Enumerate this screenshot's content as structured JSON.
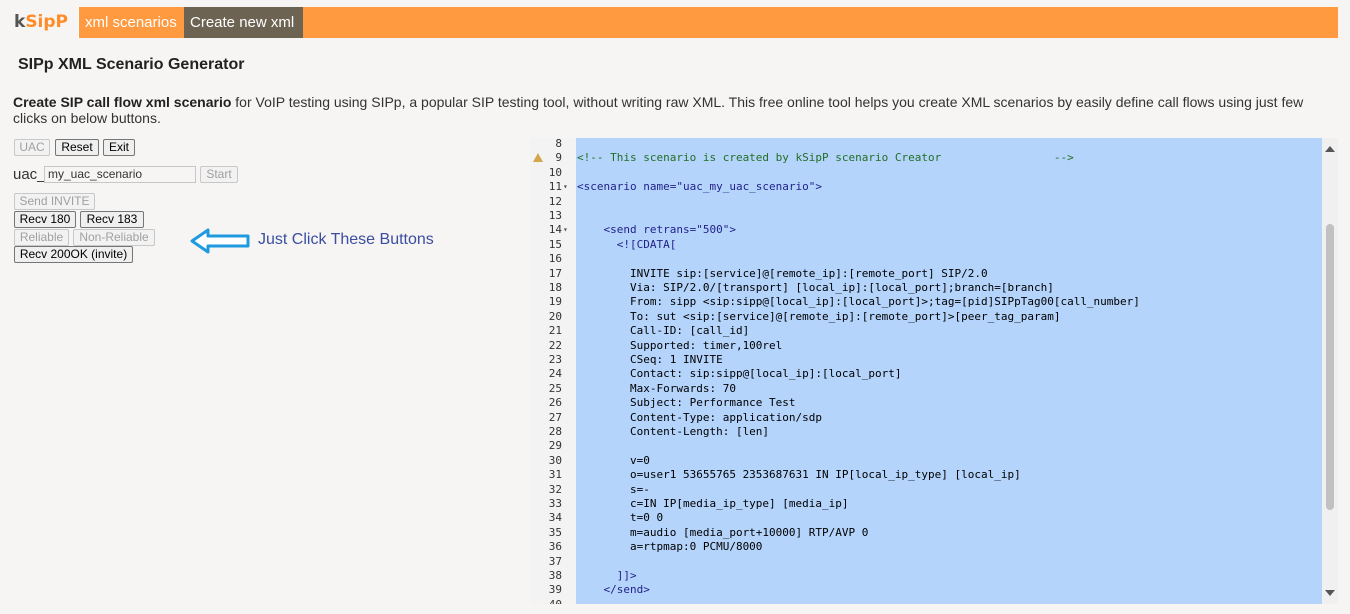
{
  "header": {
    "logo_k": "k",
    "logo_rest": "SipP",
    "tabs": [
      {
        "label": "xml scenarios"
      },
      {
        "label": "Create new xml"
      }
    ]
  },
  "main": {
    "title": "SIPp XML Scenario Generator",
    "desc_bold": "Create SIP call flow xml scenario",
    "desc_rest": " for VoIP testing using SIPp, a popular SIP testing tool, without writing raw XML. This free online tool helps you create XML scenarios by easily define call flows using just few clicks on below buttons."
  },
  "controls": {
    "uac": "UAC",
    "reset": "Reset",
    "exit": "Exit",
    "uac_prefix": "uac_",
    "scenario_name": "my_uac_scenario",
    "start": "Start",
    "send_invite": "Send INVITE",
    "recv180": "Recv 180",
    "recv183": "Recv 183",
    "reliable": "Reliable",
    "non_reliable": "Non-Reliable",
    "recv200": "Recv 200OK (invite)",
    "hint": "Just Click These Buttons"
  },
  "editor": {
    "lines": [
      {
        "n": "8",
        "text": ""
      },
      {
        "n": "9",
        "text": "<!-- This scenario is created by kSipP scenario Creator                 -->",
        "kind": "comment",
        "warn": true
      },
      {
        "n": "10",
        "text": ""
      },
      {
        "n": "11",
        "text": "<scenario name=\"uac_my_uac_scenario\">",
        "kind": "tag",
        "fold": true
      },
      {
        "n": "12",
        "text": ""
      },
      {
        "n": "13",
        "text": ""
      },
      {
        "n": "14",
        "text": "    <send retrans=\"500\">",
        "kind": "tag",
        "fold": true
      },
      {
        "n": "15",
        "text": "      <![CDATA[",
        "kind": "tag"
      },
      {
        "n": "16",
        "text": ""
      },
      {
        "n": "17",
        "text": "        INVITE sip:[service]@[remote_ip]:[remote_port] SIP/2.0"
      },
      {
        "n": "18",
        "text": "        Via: SIP/2.0/[transport] [local_ip]:[local_port];branch=[branch]"
      },
      {
        "n": "19",
        "text": "        From: sipp <sip:sipp@[local_ip]:[local_port]>;tag=[pid]SIPpTag00[call_number]"
      },
      {
        "n": "20",
        "text": "        To: sut <sip:[service]@[remote_ip]:[remote_port]>[peer_tag_param]"
      },
      {
        "n": "21",
        "text": "        Call-ID: [call_id]"
      },
      {
        "n": "22",
        "text": "        Supported: timer,100rel"
      },
      {
        "n": "23",
        "text": "        CSeq: 1 INVITE"
      },
      {
        "n": "24",
        "text": "        Contact: sip:sipp@[local_ip]:[local_port]"
      },
      {
        "n": "25",
        "text": "        Max-Forwards: 70"
      },
      {
        "n": "26",
        "text": "        Subject: Performance Test"
      },
      {
        "n": "27",
        "text": "        Content-Type: application/sdp"
      },
      {
        "n": "28",
        "text": "        Content-Length: [len]"
      },
      {
        "n": "29",
        "text": ""
      },
      {
        "n": "30",
        "text": "        v=0"
      },
      {
        "n": "31",
        "text": "        o=user1 53655765 2353687631 IN IP[local_ip_type] [local_ip]"
      },
      {
        "n": "32",
        "text": "        s=-"
      },
      {
        "n": "33",
        "text": "        c=IN IP[media_ip_type] [media_ip]"
      },
      {
        "n": "34",
        "text": "        t=0 0"
      },
      {
        "n": "35",
        "text": "        m=audio [media_port+10000] RTP/AVP 0"
      },
      {
        "n": "36",
        "text": "        a=rtpmap:0 PCMU/8000"
      },
      {
        "n": "37",
        "text": ""
      },
      {
        "n": "38",
        "text": "      ]]>",
        "kind": "tag"
      },
      {
        "n": "39",
        "text": "    </send>",
        "kind": "tag"
      },
      {
        "n": "40",
        "text": ""
      }
    ]
  }
}
